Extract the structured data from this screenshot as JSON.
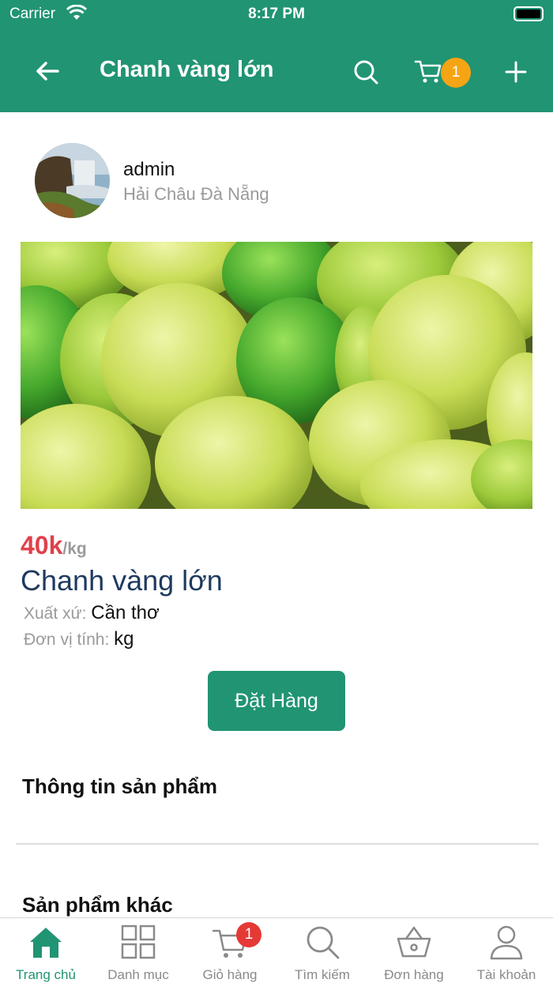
{
  "status_bar": {
    "carrier": "Carrier",
    "time": "8:17 PM"
  },
  "header": {
    "title": "Chanh vàng lớn",
    "cart_count": "1",
    "background": "#219473"
  },
  "seller": {
    "name": "admin",
    "location": "Hải Châu Đà Nẵng"
  },
  "product": {
    "price": "40k",
    "unit": "/kg",
    "name": "Chanh vàng lớn",
    "origin_label": "Xuất xứ:",
    "origin_value": "Cần thơ",
    "uom_label": "Đơn vị tính:",
    "uom_value": "kg",
    "order_label": "Đặt Hàng"
  },
  "sections": {
    "info_title": "Thông tin sản phẩm",
    "other_title": "Sản phẩm khác"
  },
  "tabbar": {
    "items": [
      {
        "label": "Trang chủ",
        "icon": "home-icon",
        "active": true
      },
      {
        "label": "Danh mục",
        "icon": "grid-icon"
      },
      {
        "label": "Giỏ hàng",
        "icon": "cart-icon",
        "badge": "1"
      },
      {
        "label": "Tìm kiếm",
        "icon": "search-icon"
      },
      {
        "label": "Đơn hàng",
        "icon": "basket-icon"
      },
      {
        "label": "Tài khoản",
        "icon": "user-icon"
      }
    ]
  },
  "colors": {
    "accent": "#219473",
    "price": "#e0404c",
    "name": "#1e3a5f",
    "badge": "#f5a414"
  }
}
